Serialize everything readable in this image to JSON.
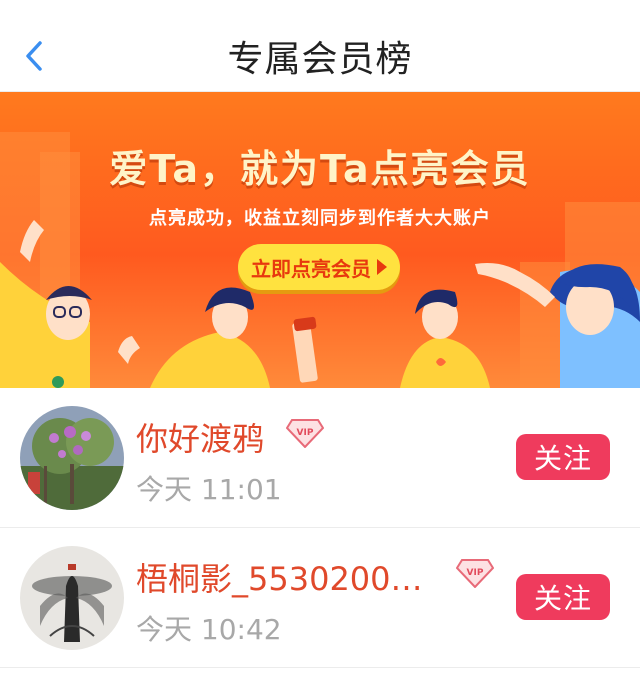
{
  "header": {
    "title": "专属会员榜",
    "back_icon": "chevron-left-icon"
  },
  "banner": {
    "headline": "爱Ta，就为Ta点亮会员",
    "subtitle": "点亮成功，收益立刻同步到作者大大账户",
    "cta_label": "立即点亮会员",
    "colors": {
      "background": "#ff6a1f",
      "cta": "#ffe23f",
      "cta_text": "#e8380e"
    }
  },
  "members": [
    {
      "name": "你好渡鸦",
      "badge": "VIP",
      "time": "今天 11:01",
      "follow_label": "关注"
    },
    {
      "name": "梧桐影_5530200…",
      "badge": "VIP",
      "time": "今天 10:42",
      "follow_label": "关注"
    }
  ],
  "colors": {
    "accent": "#3a8ef0",
    "name": "#e0492b",
    "follow": "#ef3b5d"
  }
}
